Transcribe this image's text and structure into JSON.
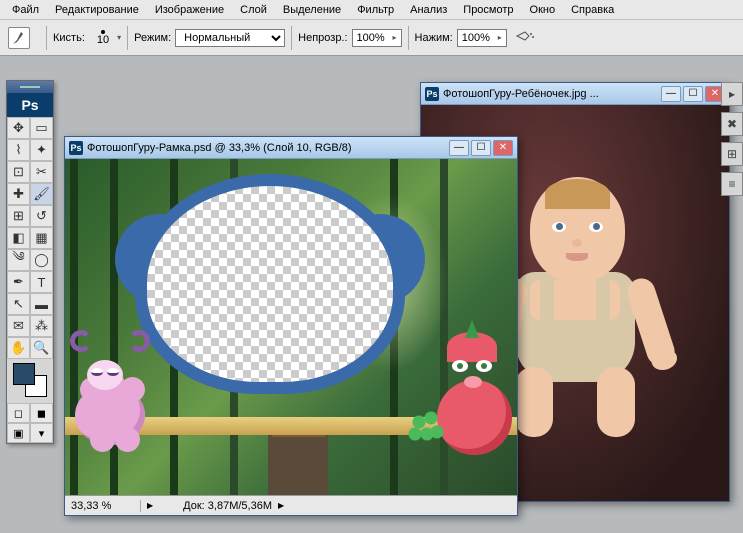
{
  "menu": {
    "items": [
      "Файл",
      "Редактирование",
      "Изображение",
      "Слой",
      "Выделение",
      "Фильтр",
      "Анализ",
      "Просмотр",
      "Окно",
      "Справка"
    ]
  },
  "options": {
    "brush_label": "Кисть:",
    "brush_size": "10",
    "mode_label": "Режим:",
    "mode_value": "Нормальный",
    "opacity_label": "Непрозр.:",
    "opacity_value": "100%",
    "flow_label": "Нажим:",
    "flow_value": "100%"
  },
  "tools": {
    "logo": "Ps"
  },
  "doc_frame": {
    "title": "ФотошопГуру-Рамка.psd @ 33,3% (Слой 10, RGB/8)"
  },
  "doc_baby": {
    "title": "ФотошопГуру-Ребёночек.jpg ..."
  },
  "status": {
    "zoom": "33,33 %",
    "doc_label": "Док:",
    "doc_size": "3,87M/5,36M"
  }
}
